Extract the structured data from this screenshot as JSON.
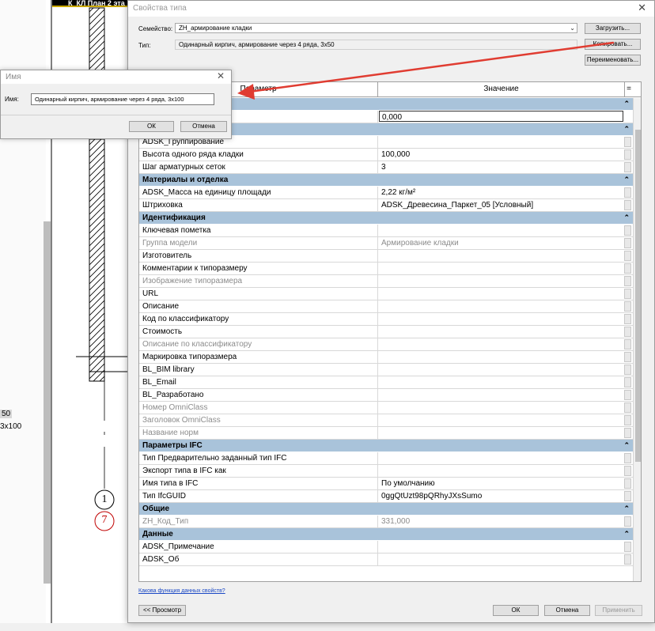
{
  "cad": {
    "tab_label": "К_КЛ План 2 эта",
    "left_lines": [
      "50",
      "3х100"
    ],
    "grid_marks": [
      "1",
      "7"
    ]
  },
  "type_dialog": {
    "title": "Свойства типа",
    "family_label": "Семейство:",
    "family_value": "ZH_армирование кладки",
    "type_label": "Тип:",
    "type_value": "Одинарный кирпич, армирование через 4 ряда, 3х50",
    "load_button": "Загрузить...",
    "copy_button": "Копировать...",
    "rename_button": "Переименовать...",
    "col_param": "Параметр",
    "col_value": "Значение",
    "col_eq": "=",
    "groups": [
      {
        "title": "",
        "rows": [
          {
            "name": "",
            "value": "0,000",
            "disabled": false,
            "edit": true
          }
        ]
      },
      {
        "title": "",
        "rows": [
          {
            "name": "ADSK_Группирование",
            "value": "",
            "disabled": false
          },
          {
            "name": "Высота одного ряда кладки",
            "value": "100,000",
            "disabled": false
          },
          {
            "name": "Шаг арматурных сеток",
            "value": "3",
            "disabled": false
          }
        ]
      },
      {
        "title": "Материалы и отделка",
        "rows": [
          {
            "name": "ADSK_Масса на единицу площади",
            "value": "2,22 кг/м²",
            "disabled": false
          },
          {
            "name": "Штриховка",
            "value": "ADSK_Древесина_Паркет_05 [Условный]",
            "disabled": false
          }
        ]
      },
      {
        "title": "Идентификация",
        "rows": [
          {
            "name": "Ключевая пометка",
            "value": "",
            "disabled": false
          },
          {
            "name": "Группа модели",
            "value": "Армирование кладки",
            "disabled": true
          },
          {
            "name": "Изготовитель",
            "value": "",
            "disabled": false
          },
          {
            "name": "Комментарии к типоразмеру",
            "value": "",
            "disabled": false
          },
          {
            "name": "Изображение типоразмера",
            "value": "",
            "disabled": true
          },
          {
            "name": "URL",
            "value": "",
            "disabled": false
          },
          {
            "name": "Описание",
            "value": "",
            "disabled": false
          },
          {
            "name": "Код по классификатору",
            "value": "",
            "disabled": false
          },
          {
            "name": "Стоимость",
            "value": "",
            "disabled": false
          },
          {
            "name": "Описание по классификатору",
            "value": "",
            "disabled": true
          },
          {
            "name": "Маркировка типоразмера",
            "value": "",
            "disabled": false
          },
          {
            "name": "BL_BIM library",
            "value": "",
            "disabled": false
          },
          {
            "name": "BL_Email",
            "value": "",
            "disabled": false
          },
          {
            "name": "BL_Разработано",
            "value": "",
            "disabled": false
          },
          {
            "name": "Номер OmniClass",
            "value": "",
            "disabled": true
          },
          {
            "name": "Заголовок OmniClass",
            "value": "",
            "disabled": true
          },
          {
            "name": "Название норм",
            "value": "",
            "disabled": true
          }
        ]
      },
      {
        "title": "Параметры IFC",
        "rows": [
          {
            "name": "Тип Предварительно заданный тип IFC",
            "value": "",
            "disabled": false
          },
          {
            "name": "Экспорт типа в IFC как",
            "value": "",
            "disabled": false
          },
          {
            "name": "Имя типа в IFC",
            "value": "По умолчанию",
            "disabled": false
          },
          {
            "name": "Тип IfcGUID",
            "value": "0ggQtUzt98pQRhyJXsSumo",
            "disabled": false
          }
        ]
      },
      {
        "title": "Общие",
        "rows": [
          {
            "name": "ZH_Код_Тип",
            "value": "331,000",
            "disabled": true
          }
        ]
      },
      {
        "title": "Данные",
        "rows": [
          {
            "name": "ADSK_Примечание",
            "value": "",
            "disabled": false
          },
          {
            "name": "ADSK_Об",
            "value": "",
            "disabled": false
          }
        ]
      }
    ],
    "help_link": "Какова функция данных свойств?",
    "preview_button": "<< Просмотр",
    "ok_button": "ОК",
    "cancel_button": "Отмена",
    "apply_button": "Применить"
  },
  "name_dialog": {
    "title": "Имя",
    "name_label": "Имя:",
    "name_value": "Одинарный кирпич, армирование через 4 ряда, 3х100",
    "ok_button": "ОК",
    "cancel_button": "Отмена"
  },
  "colors": {
    "group_header": "#a9c3da",
    "annotation_arrow": "#e03c31",
    "link": "#1a48c5"
  }
}
